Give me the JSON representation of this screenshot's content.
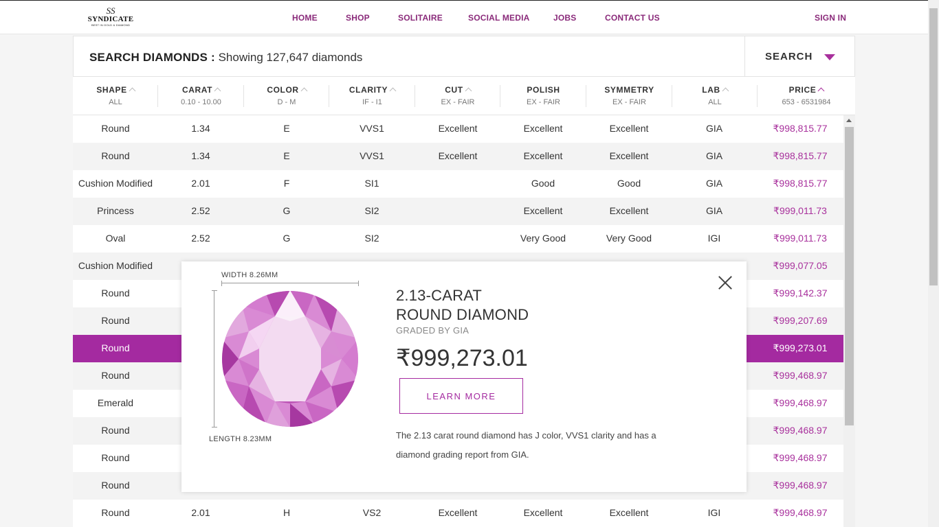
{
  "header": {
    "logo": {
      "mark": "SS",
      "name": "SYNDICATE",
      "tagline": "BEST IN GOLD & DIAMOND"
    },
    "nav": [
      "HOME",
      "SHOP",
      "SOLITAIRE",
      "SOCIAL MEDIA",
      "JOBS",
      "CONTACT US"
    ],
    "sign_in": "SIGN IN"
  },
  "search": {
    "title": "SEARCH DIAMONDS :",
    "count_text": "Showing 127,647 diamonds",
    "button": "SEARCH"
  },
  "columns": [
    {
      "name": "SHAPE",
      "range": "ALL",
      "sort": "up"
    },
    {
      "name": "CARAT",
      "range": "0.10 - 10.00",
      "sort": "up"
    },
    {
      "name": "COLOR",
      "range": "D - M",
      "sort": "up"
    },
    {
      "name": "CLARITY",
      "range": "IF - I1",
      "sort": "up"
    },
    {
      "name": "CUT",
      "range": "EX - FAIR",
      "sort": "up"
    },
    {
      "name": "POLISH",
      "range": "EX - FAIR",
      "sort": ""
    },
    {
      "name": "SYMMETRY",
      "range": "EX - FAIR",
      "sort": ""
    },
    {
      "name": "LAB",
      "range": "ALL",
      "sort": "up"
    },
    {
      "name": "PRICE",
      "range": "653 - 6531984",
      "sort": "active"
    }
  ],
  "rows": [
    {
      "shape": "Round",
      "carat": "1.34",
      "color": "E",
      "clarity": "VVS1",
      "cut": "Excellent",
      "polish": "Excellent",
      "symmetry": "Excellent",
      "lab": "GIA",
      "price": "₹998,815.77"
    },
    {
      "shape": "Round",
      "carat": "1.34",
      "color": "E",
      "clarity": "VVS1",
      "cut": "Excellent",
      "polish": "Excellent",
      "symmetry": "Excellent",
      "lab": "GIA",
      "price": "₹998,815.77"
    },
    {
      "shape": "Cushion Modified",
      "carat": "2.01",
      "color": "F",
      "clarity": "SI1",
      "cut": "",
      "polish": "Good",
      "symmetry": "Good",
      "lab": "GIA",
      "price": "₹998,815.77"
    },
    {
      "shape": "Princess",
      "carat": "2.52",
      "color": "G",
      "clarity": "SI2",
      "cut": "",
      "polish": "Excellent",
      "symmetry": "Excellent",
      "lab": "GIA",
      "price": "₹999,011.73"
    },
    {
      "shape": "Oval",
      "carat": "2.52",
      "color": "G",
      "clarity": "SI2",
      "cut": "",
      "polish": "Very Good",
      "symmetry": "Very Good",
      "lab": "IGI",
      "price": "₹999,011.73"
    },
    {
      "shape": "Cushion Modified",
      "carat": "",
      "color": "",
      "clarity": "",
      "cut": "",
      "polish": "",
      "symmetry": "",
      "lab": "",
      "price": "₹999,077.05"
    },
    {
      "shape": "Round",
      "carat": "",
      "color": "",
      "clarity": "",
      "cut": "",
      "polish": "",
      "symmetry": "",
      "lab": "",
      "price": "₹999,142.37"
    },
    {
      "shape": "Round",
      "carat": "",
      "color": "",
      "clarity": "",
      "cut": "",
      "polish": "",
      "symmetry": "",
      "lab": "",
      "price": "₹999,207.69"
    },
    {
      "shape": "Round",
      "carat": "",
      "color": "",
      "clarity": "",
      "cut": "",
      "polish": "",
      "symmetry": "",
      "lab": "",
      "price": "₹999,273.01",
      "selected": true
    },
    {
      "shape": "Round",
      "carat": "",
      "color": "",
      "clarity": "",
      "cut": "",
      "polish": "",
      "symmetry": "",
      "lab": "",
      "price": "₹999,468.97"
    },
    {
      "shape": "Emerald",
      "carat": "",
      "color": "",
      "clarity": "",
      "cut": "",
      "polish": "",
      "symmetry": "",
      "lab": "",
      "price": "₹999,468.97"
    },
    {
      "shape": "Round",
      "carat": "",
      "color": "",
      "clarity": "",
      "cut": "",
      "polish": "",
      "symmetry": "",
      "lab": "",
      "price": "₹999,468.97"
    },
    {
      "shape": "Round",
      "carat": "",
      "color": "",
      "clarity": "",
      "cut": "",
      "polish": "",
      "symmetry": "",
      "lab": "",
      "price": "₹999,468.97"
    },
    {
      "shape": "Round",
      "carat": "",
      "color": "",
      "clarity": "",
      "cut": "",
      "polish": "",
      "symmetry": "",
      "lab": "",
      "price": "₹999,468.97"
    },
    {
      "shape": "Round",
      "carat": "2.01",
      "color": "H",
      "clarity": "VS2",
      "cut": "Excellent",
      "polish": "Excellent",
      "symmetry": "Excellent",
      "lab": "IGI",
      "price": "₹999,468.97"
    }
  ],
  "modal": {
    "width_label": "WIDTH 8.26MM",
    "length_label": "LENGTH 8.23MM",
    "title_line1": "2.13-CARAT",
    "title_line2": "ROUND DIAMOND",
    "graded": "GRADED BY GIA",
    "price": "₹999,273.01",
    "learn_more": "LEARN MORE",
    "description": "The 2.13 carat round diamond has J color, VVS1 clarity and has a diamond grading report from GIA."
  },
  "colors": {
    "accent": "#a42aa0",
    "price": "#a8309c",
    "nav": "#8a2a7a"
  }
}
